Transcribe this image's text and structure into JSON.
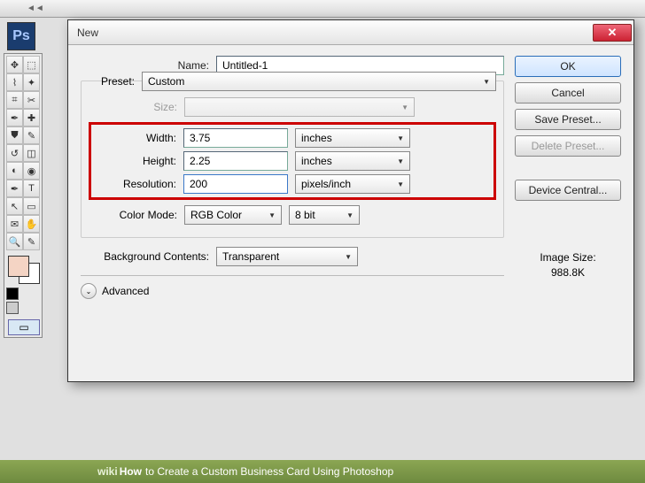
{
  "app": {
    "logo": "Ps"
  },
  "dialog": {
    "title": "New",
    "name_label": "Name:",
    "name_value": "Untitled-1",
    "preset_label": "Preset:",
    "preset_value": "Custom",
    "size_label": "Size:",
    "width_label": "Width:",
    "width_value": "3.75",
    "width_unit": "inches",
    "height_label": "Height:",
    "height_value": "2.25",
    "height_unit": "inches",
    "resolution_label": "Resolution:",
    "resolution_value": "200",
    "resolution_unit": "pixels/inch",
    "colormode_label": "Color Mode:",
    "colormode_value": "RGB Color",
    "colordepth_value": "8 bit",
    "bgcontents_label": "Background Contents:",
    "bgcontents_value": "Transparent",
    "advanced_label": "Advanced",
    "image_size_label": "Image Size:",
    "image_size_value": "988.8K"
  },
  "buttons": {
    "ok": "OK",
    "cancel": "Cancel",
    "save_preset": "Save Preset...",
    "delete_preset": "Delete Preset...",
    "device_central": "Device Central..."
  },
  "caption": {
    "wiki": "wiki",
    "how": "How",
    "text": " to Create a Custom Business Card Using Photoshop"
  }
}
